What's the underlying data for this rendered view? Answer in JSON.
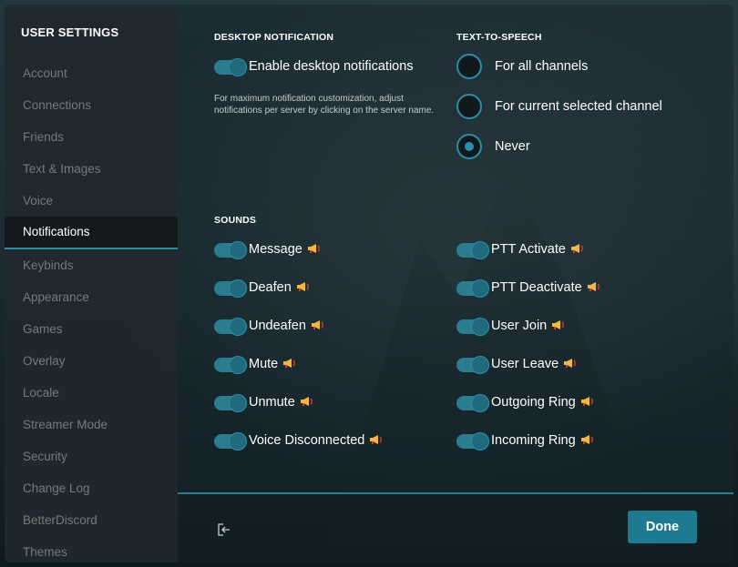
{
  "sidebar": {
    "title": "USER SETTINGS",
    "items": [
      {
        "label": "Account"
      },
      {
        "label": "Connections"
      },
      {
        "label": "Friends"
      },
      {
        "label": "Text & Images"
      },
      {
        "label": "Voice"
      },
      {
        "label": "Notifications",
        "active": true
      },
      {
        "label": "Keybinds"
      },
      {
        "label": "Appearance"
      },
      {
        "label": "Games"
      },
      {
        "label": "Overlay"
      },
      {
        "label": "Locale"
      },
      {
        "label": "Streamer Mode"
      },
      {
        "label": "Security"
      },
      {
        "label": "Change Log"
      },
      {
        "label": "BetterDiscord"
      },
      {
        "label": "Themes"
      }
    ]
  },
  "desktop_notification": {
    "title": "DESKTOP NOTIFICATION",
    "enable_label": "Enable desktop notifications",
    "enabled": true,
    "hint": "For maximum notification customization, adjust notifications per server by clicking on the server name."
  },
  "tts": {
    "title": "TEXT-TO-SPEECH",
    "options": [
      {
        "label": "For all channels",
        "selected": false
      },
      {
        "label": "For current selected channel",
        "selected": false
      },
      {
        "label": "Never",
        "selected": true
      }
    ]
  },
  "sounds": {
    "title": "SOUNDS",
    "left": [
      {
        "label": "Message",
        "enabled": true
      },
      {
        "label": "Deafen",
        "enabled": true
      },
      {
        "label": "Undeafen",
        "enabled": true
      },
      {
        "label": "Mute",
        "enabled": true
      },
      {
        "label": "Unmute",
        "enabled": true
      },
      {
        "label": "Voice Disconnected",
        "enabled": true
      }
    ],
    "right": [
      {
        "label": "PTT Activate",
        "enabled": true
      },
      {
        "label": "PTT Deactivate",
        "enabled": true
      },
      {
        "label": "User Join",
        "enabled": true
      },
      {
        "label": "User Leave",
        "enabled": true
      },
      {
        "label": "Outgoing Ring",
        "enabled": true
      },
      {
        "label": "Incoming Ring",
        "enabled": true
      }
    ],
    "preview_icon": "megaphone-icon"
  },
  "footer": {
    "exit_icon": "exit-icon",
    "done_label": "Done"
  },
  "colors": {
    "accent": "#2a8fa5",
    "toggle_on": "#2a7d91",
    "done_button": "#1e7a90",
    "megaphone": "#f0b840"
  }
}
